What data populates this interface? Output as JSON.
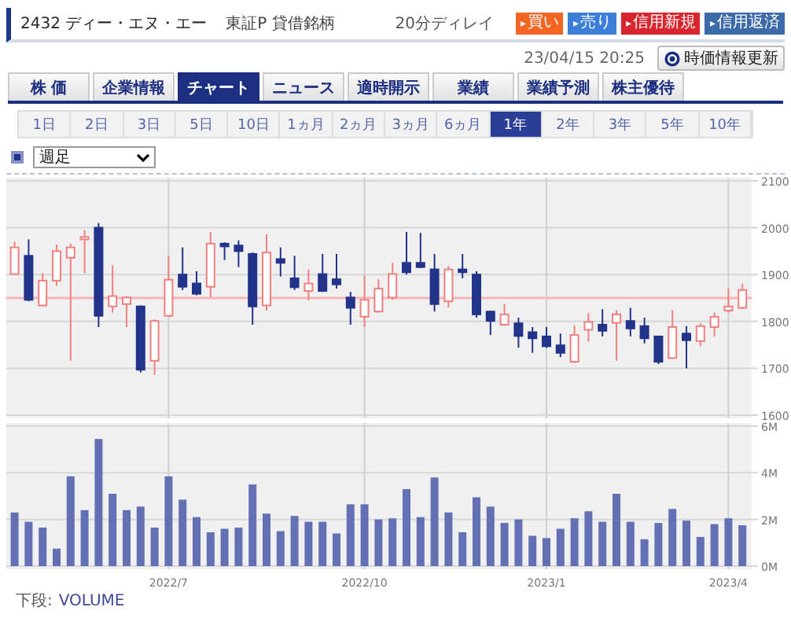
{
  "header": {
    "code_name": "2432 ディー・エヌ・エー",
    "market": "東証P 貸借銘柄",
    "delay": "20分ディレイ",
    "actions": [
      {
        "kind": "buy",
        "label": "買い",
        "marker": "▸"
      },
      {
        "kind": "sell",
        "label": "売り",
        "marker": "▸"
      },
      {
        "kind": "margin_new",
        "label": "信用新規",
        "marker": "▸"
      },
      {
        "kind": "margin_close",
        "label": "信用返済",
        "marker": "▸"
      }
    ]
  },
  "timestamp": "23/04/15 20:25",
  "refresh_button": "時価情報更新",
  "tabs": [
    {
      "label": "株 価",
      "selected": false
    },
    {
      "label": "企業情報",
      "selected": false
    },
    {
      "label": "チャート",
      "selected": true
    },
    {
      "label": "ニュース",
      "selected": false
    },
    {
      "label": "適時開示",
      "selected": false
    },
    {
      "label": "業績",
      "selected": false
    },
    {
      "label": "業績予測",
      "selected": false
    },
    {
      "label": "株主優待",
      "selected": false
    }
  ],
  "periods": [
    {
      "label": "1日",
      "selected": false
    },
    {
      "label": "2日",
      "selected": false
    },
    {
      "label": "3日",
      "selected": false
    },
    {
      "label": "5日",
      "selected": false
    },
    {
      "label": "10日",
      "selected": false
    },
    {
      "label": "1ヵ月",
      "selected": false
    },
    {
      "label": "2ヵ月",
      "selected": false
    },
    {
      "label": "3ヵ月",
      "selected": false
    },
    {
      "label": "6ヵ月",
      "selected": false
    },
    {
      "label": "1年",
      "selected": true
    },
    {
      "label": "2年",
      "selected": false
    },
    {
      "label": "3年",
      "selected": false
    },
    {
      "label": "5年",
      "selected": false
    },
    {
      "label": "10年",
      "selected": false
    }
  ],
  "interval_select": {
    "value": "週足"
  },
  "price_chart": {
    "chart_data": {
      "type": "candlestick",
      "categories": [
        null,
        null,
        null,
        null,
        null,
        null,
        null,
        null,
        null,
        null,
        null,
        null,
        null,
        null,
        null,
        null,
        null,
        null,
        null,
        null,
        null,
        null,
        null,
        null,
        null,
        null,
        null,
        null,
        null,
        null,
        null,
        null,
        null,
        null,
        null,
        null,
        null,
        null,
        null,
        null,
        null,
        null,
        null,
        null,
        null,
        null,
        null,
        null,
        null,
        null,
        null,
        null,
        null
      ],
      "ylim": [
        1600,
        2100
      ],
      "yticks": [
        1600,
        1700,
        1800,
        1900,
        2000,
        2100
      ],
      "ohlc": [
        [
          1901,
          1970,
          1900,
          1958
        ],
        [
          1940,
          1975,
          1843,
          1846
        ],
        [
          1834,
          1903,
          1832,
          1887
        ],
        [
          1887,
          1964,
          1876,
          1950
        ],
        [
          1936,
          1966,
          1716,
          1958
        ],
        [
          1975,
          1995,
          1903,
          1980
        ],
        [
          2000,
          2010,
          1788,
          1812
        ],
        [
          1832,
          1920,
          1819,
          1854
        ],
        [
          1837,
          1854,
          1788,
          1851
        ],
        [
          1832,
          1834,
          1691,
          1697
        ],
        [
          1716,
          1804,
          1686,
          1801
        ],
        [
          1812,
          1940,
          1810,
          1889
        ],
        [
          1900,
          1958,
          1867,
          1874
        ],
        [
          1881,
          1907,
          1856,
          1859
        ],
        [
          1874,
          1991,
          1852,
          1966
        ],
        [
          1966,
          1969,
          1931,
          1960
        ],
        [
          1962,
          1973,
          1916,
          1950
        ],
        [
          1944,
          1947,
          1793,
          1832
        ],
        [
          1834,
          1986,
          1823,
          1947
        ],
        [
          1933,
          1958,
          1896,
          1925
        ],
        [
          1892,
          1940,
          1867,
          1873
        ],
        [
          1865,
          1911,
          1845,
          1881
        ],
        [
          1901,
          1944,
          1863,
          1865
        ],
        [
          1890,
          1944,
          1870,
          1879
        ],
        [
          1851,
          1863,
          1793,
          1829
        ],
        [
          1810,
          1898,
          1788,
          1846
        ],
        [
          1821,
          1890,
          1819,
          1870
        ],
        [
          1851,
          1925,
          1846,
          1901
        ],
        [
          1925,
          1991,
          1900,
          1905
        ],
        [
          1925,
          1989,
          1914,
          1916
        ],
        [
          1911,
          1944,
          1821,
          1837
        ],
        [
          1843,
          1918,
          1830,
          1911
        ],
        [
          1911,
          1944,
          1892,
          1905
        ],
        [
          1900,
          1907,
          1808,
          1815
        ],
        [
          1821,
          1823,
          1771,
          1801
        ],
        [
          1793,
          1837,
          1791,
          1815
        ],
        [
          1796,
          1808,
          1744,
          1769
        ],
        [
          1777,
          1788,
          1733,
          1764
        ],
        [
          1768,
          1788,
          1744,
          1747
        ],
        [
          1749,
          1774,
          1724,
          1733
        ],
        [
          1714,
          1791,
          1711,
          1771
        ],
        [
          1782,
          1818,
          1757,
          1799
        ],
        [
          1793,
          1826,
          1768,
          1780
        ],
        [
          1797,
          1824,
          1716,
          1815
        ],
        [
          1801,
          1829,
          1768,
          1785
        ],
        [
          1790,
          1808,
          1753,
          1764
        ],
        [
          1768,
          1769,
          1709,
          1714
        ],
        [
          1722,
          1824,
          1720,
          1788
        ],
        [
          1774,
          1790,
          1700,
          1760
        ],
        [
          1758,
          1796,
          1747,
          1790
        ],
        [
          1788,
          1819,
          1768,
          1810
        ],
        [
          1823,
          1870,
          1819,
          1832
        ],
        [
          1829,
          1881,
          1826,
          1867
        ]
      ],
      "grid": true,
      "ref_lines": [
        {
          "axis": "y",
          "value": 1850
        }
      ]
    }
  },
  "volume_chart": {
    "chart_data": {
      "type": "bar",
      "grid": true,
      "categories": [
        null,
        null,
        null,
        null,
        null,
        null,
        null,
        null,
        null,
        null,
        null,
        "2022/7",
        null,
        null,
        null,
        null,
        null,
        null,
        null,
        null,
        null,
        null,
        null,
        null,
        null,
        "2022/10",
        null,
        null,
        null,
        null,
        null,
        null,
        null,
        null,
        null,
        null,
        null,
        null,
        "2023/1",
        null,
        null,
        null,
        null,
        null,
        null,
        null,
        null,
        null,
        null,
        null,
        null,
        "2023/4",
        null
      ],
      "ylim": [
        0,
        6
      ],
      "yticks": [
        {
          "value": 0,
          "label": "0M"
        },
        {
          "value": 2,
          "label": "2M"
        },
        {
          "value": 4,
          "label": "4M"
        },
        {
          "value": 6,
          "label": "6M"
        }
      ],
      "series": [
        {
          "name": "VOLUME",
          "color": "#6470b4",
          "values": [
            2.3,
            1.9,
            1.65,
            0.75,
            3.85,
            2.4,
            5.45,
            3.1,
            2.4,
            2.55,
            1.65,
            3.85,
            2.85,
            2.1,
            1.45,
            1.6,
            1.65,
            3.5,
            2.25,
            1.5,
            2.15,
            1.9,
            1.9,
            1.4,
            2.65,
            2.65,
            2.0,
            2.05,
            3.3,
            2.1,
            3.8,
            2.3,
            1.45,
            2.95,
            2.55,
            1.85,
            2.0,
            1.3,
            1.2,
            1.6,
            2.05,
            2.35,
            1.9,
            3.1,
            1.9,
            1.15,
            1.85,
            2.45,
            1.95,
            1.25,
            1.8,
            2.05,
            1.75
          ]
        }
      ]
    }
  },
  "lower_caption": {
    "label": "下段:"
  }
}
